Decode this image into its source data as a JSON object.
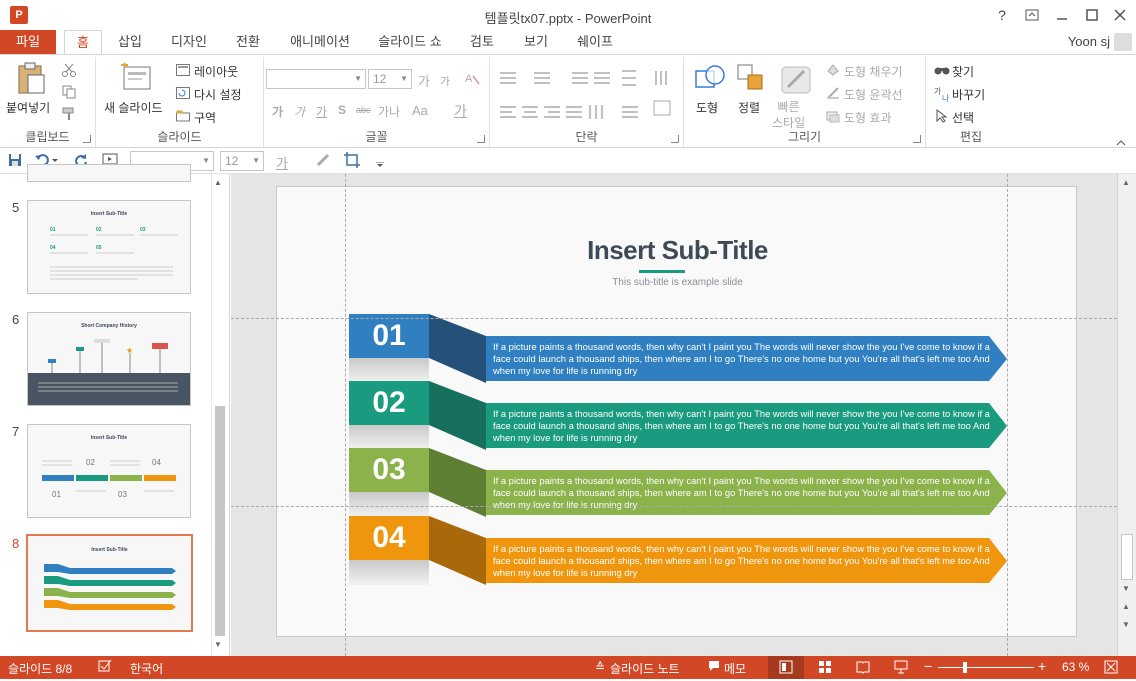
{
  "window": {
    "title": "템플릿tx07.pptx - PowerPoint",
    "app_icon": "P",
    "help": "?",
    "user": "Yoon sj"
  },
  "tabs": [
    "파일",
    "홈",
    "삽입",
    "디자인",
    "전환",
    "애니메이션",
    "슬라이드 쇼",
    "검토",
    "보기",
    "쉐이프"
  ],
  "ribbon": {
    "clipboard": {
      "paste": "붙여넣기",
      "label": "클립보드"
    },
    "slides": {
      "new_slide": "새 슬라이드",
      "layout": "레이아웃",
      "reset": "다시 설정",
      "section": "구역",
      "label": "슬라이드"
    },
    "font": {
      "size": "12",
      "bold": "가",
      "italic": "가",
      "underline": "가",
      "strike": "S",
      "spacing": "가나",
      "aa": "Aa",
      "color": "가",
      "grow": "가",
      "shrink": "가",
      "label": "글꼴"
    },
    "paragraph": {
      "label": "단락"
    },
    "drawing": {
      "shape": "도형",
      "arrange": "정렬",
      "quick_style": "빠른\n스타일",
      "fill": "도형 채우기",
      "outline": "도형 윤곽선",
      "effect": "도형 효과",
      "label": "그리기"
    },
    "editing": {
      "find": "찾기",
      "replace": "바꾸기",
      "select": "선택",
      "label": "편집"
    }
  },
  "qat": {
    "font_size": "12",
    "font_color": "가"
  },
  "thumbnails": [
    {
      "num": "5",
      "title": "Insert Sub-Title"
    },
    {
      "num": "6",
      "title": "Short Company History"
    },
    {
      "num": "7",
      "title": "Insert Sub-Title"
    },
    {
      "num": "8",
      "title": "Insert Sub-Title",
      "active": true
    }
  ],
  "slide": {
    "title": "Insert Sub-Title",
    "subtitle": "This sub-title is example slide",
    "items": [
      {
        "num": "01",
        "color": "#2f7fc1",
        "dark": "#24507a",
        "text": "If a picture paints a thousand words, then why can't I paint you The words will never show the you I've come to know if a face could launch a thousand ships, then where am I to go There's no one home but you You're all that's left me too And when my love for life  is running dry"
      },
      {
        "num": "02",
        "color": "#1a9b7f",
        "dark": "#17705d",
        "text": "If a picture paints a thousand words, then why can't I paint you The words will never show the you I've come to know if a face could launch a thousand ships, then where am I to go There's no one home but you You're all that's left me too And when my love for life  is running dry"
      },
      {
        "num": "03",
        "color": "#8bb24b",
        "dark": "#5d7e33",
        "text": "If a picture paints a thousand words, then why can't I paint you The words will never show the you I've come to know if a face could launch a thousand ships, then where am I to go There's no one home but you You're all that's left me too And when my love for life  is running dry"
      },
      {
        "num": "04",
        "color": "#f0960e",
        "dark": "#a9680a",
        "text": "If a picture paints a thousand words, then why can't I paint you The words will never show the you I've come to know if a face could launch a thousand ships, then where am I to go There's no one home but you You're all that's left me too And when my love for life  is running dry"
      }
    ]
  },
  "status": {
    "slide_count": "슬라이드 8/8",
    "language": "한국어",
    "notes": "슬라이드 노트",
    "comments": "메모",
    "zoom": "63 %"
  }
}
